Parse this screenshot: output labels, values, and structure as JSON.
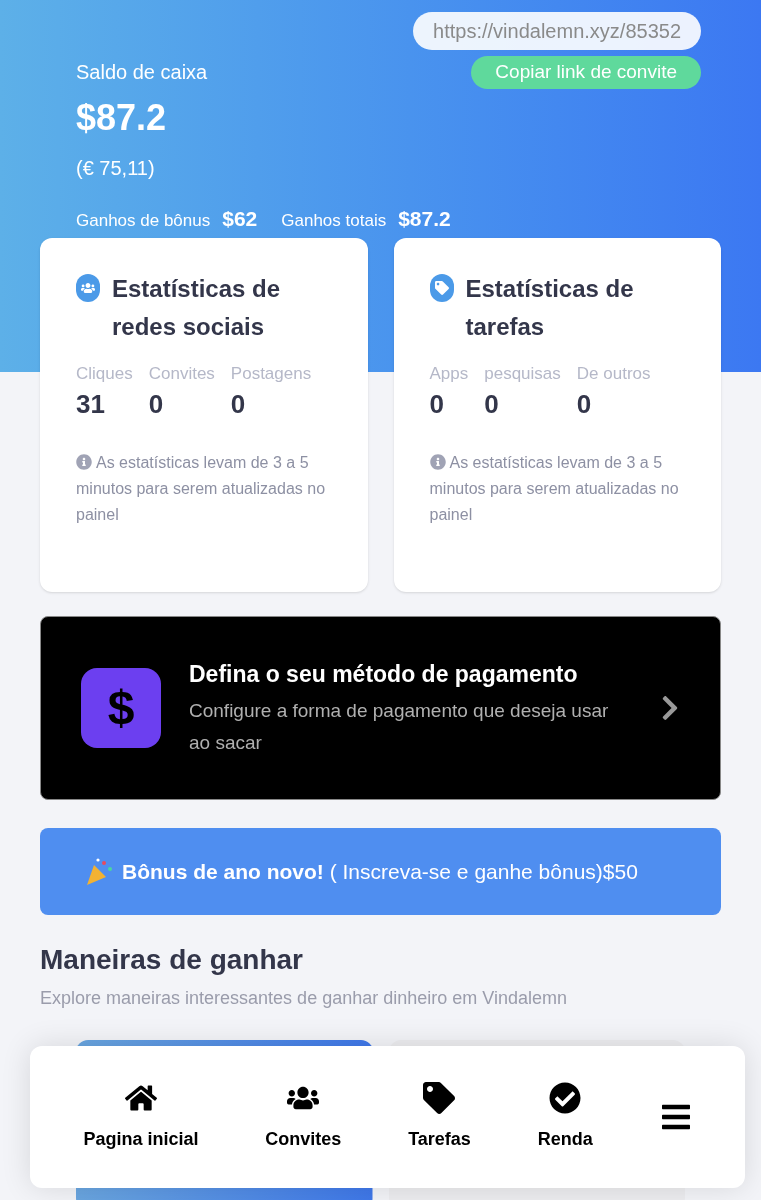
{
  "header": {
    "invite_url": "https://vindalemn.xyz/85352",
    "copy_button": "Copiar link de convite",
    "balance_label": "Saldo de caixa",
    "balance": "$87.2",
    "balance_converted": "(€ 75,11)",
    "bonus_label": "Ganhos de bônus",
    "bonus_value": "$62",
    "total_label": "Ganhos totais",
    "total_value": "$87.2"
  },
  "stat_cards": [
    {
      "kind": "social",
      "title": "Estatísticas de redes sociais",
      "stats": [
        {
          "label": "Cliques",
          "value": "31"
        },
        {
          "label": "Convites",
          "value": "0"
        },
        {
          "label": "Postagens",
          "value": "0"
        }
      ],
      "note": "As estatísticas levam de 3 a 5 minutos para serem atualizadas no painel"
    },
    {
      "kind": "tasks",
      "title": "Estatísticas de tarefas",
      "stats": [
        {
          "label": "Apps",
          "value": "0"
        },
        {
          "label": "pesquisas",
          "value": "0"
        },
        {
          "label": "De outros",
          "value": "0"
        }
      ],
      "note": "As estatísticas levam de 3 a 5 minutos para serem atualizadas no painel"
    }
  ],
  "payment_card": {
    "title": "Defina o seu método de pagamento",
    "subtitle": "Configure a forma de pagamento que deseja usar ao sacar",
    "logo": "$"
  },
  "bonus_banner": "**Bônus de ano novo!** ( Inscreva-se e ganhe bônus)$50",
  "ways": {
    "title": "Maneiras de ganhar",
    "subtitle": "Explore maneiras interessantes de ganhar dinheiro em Vindalemn"
  },
  "bottom_nav": [
    {
      "kind": "home",
      "label": "Pagina inicial"
    },
    {
      "kind": "invites",
      "label": "Convites"
    },
    {
      "kind": "tasks",
      "label": "Tarefas"
    },
    {
      "kind": "income",
      "label": "Renda"
    },
    {
      "kind": "menu"
    }
  ]
}
